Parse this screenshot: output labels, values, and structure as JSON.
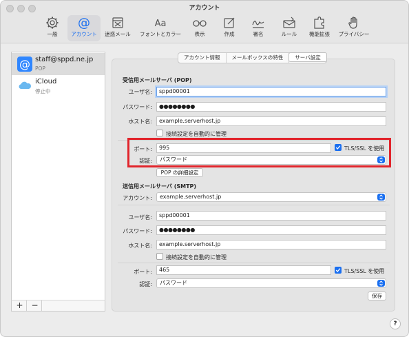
{
  "window": {
    "title": "アカウント"
  },
  "toolbar": [
    {
      "label": "一般",
      "icon": "gear-icon",
      "selected": false
    },
    {
      "label": "アカウント",
      "icon": "at-sign-icon",
      "selected": true
    },
    {
      "label": "迷惑メール",
      "icon": "junk-tray-icon",
      "selected": false
    },
    {
      "label": "フォントとカラー",
      "icon": "font-aa-icon",
      "selected": false
    },
    {
      "label": "表示",
      "icon": "glasses-icon",
      "selected": false
    },
    {
      "label": "作成",
      "icon": "compose-icon",
      "selected": false
    },
    {
      "label": "署名",
      "icon": "signature-icon",
      "selected": false
    },
    {
      "label": "ルール",
      "icon": "rules-envelope-icon",
      "selected": false
    },
    {
      "label": "機能拡張",
      "icon": "puzzle-icon",
      "selected": false
    },
    {
      "label": "プライバシー",
      "icon": "hand-icon",
      "selected": false
    }
  ],
  "accounts": [
    {
      "name": "staff@sppd.ne.jp",
      "sub": "POP",
      "icon": "at-mail-icon",
      "selected": true
    },
    {
      "name": "iCloud",
      "sub": "停止中",
      "icon": "cloud-icon",
      "selected": false
    }
  ],
  "sidebar_buttons": {
    "add": "+",
    "remove": "−"
  },
  "tabs": [
    {
      "label": "アカウント情報",
      "selected": false
    },
    {
      "label": "メールボックスの特性",
      "selected": false
    },
    {
      "label": "サーバ設定",
      "selected": true
    }
  ],
  "incoming": {
    "heading": "受信用メールサーバ (POP)",
    "username_label": "ユーザ名:",
    "username": "sppd00001",
    "password_label": "パスワード:",
    "password": "●●●●●●●●",
    "host_label": "ホスト名:",
    "host": "example.serverhost.jp",
    "auto_manage_label": "接続設定を自動的に管理",
    "auto_manage": false,
    "port_label": "ポート:",
    "port": "995",
    "tls_label": "TLS/SSL を使用",
    "tls": true,
    "auth_label": "認証:",
    "auth": "パスワード",
    "advanced_button": "POP の詳細設定"
  },
  "outgoing": {
    "heading": "送信用メールサーバ (SMTP)",
    "account_label": "アカウント:",
    "account": "example.serverhost.jp",
    "username_label": "ユーザ名:",
    "username": "sppd00001",
    "password_label": "パスワード:",
    "password": "●●●●●●●●",
    "host_label": "ホスト名:",
    "host": "example.serverhost.jp",
    "auto_manage_label": "接続設定を自動的に管理",
    "auto_manage": false,
    "port_label": "ポート:",
    "port": "465",
    "tls_label": "TLS/SSL を使用",
    "tls": true,
    "auth_label": "認証:",
    "auth": "パスワード"
  },
  "save_button": "保存",
  "help_button": "?",
  "colors": {
    "accent": "#1a6ff0",
    "highlight": "#e1242b",
    "pane": "#e4e4e4"
  }
}
